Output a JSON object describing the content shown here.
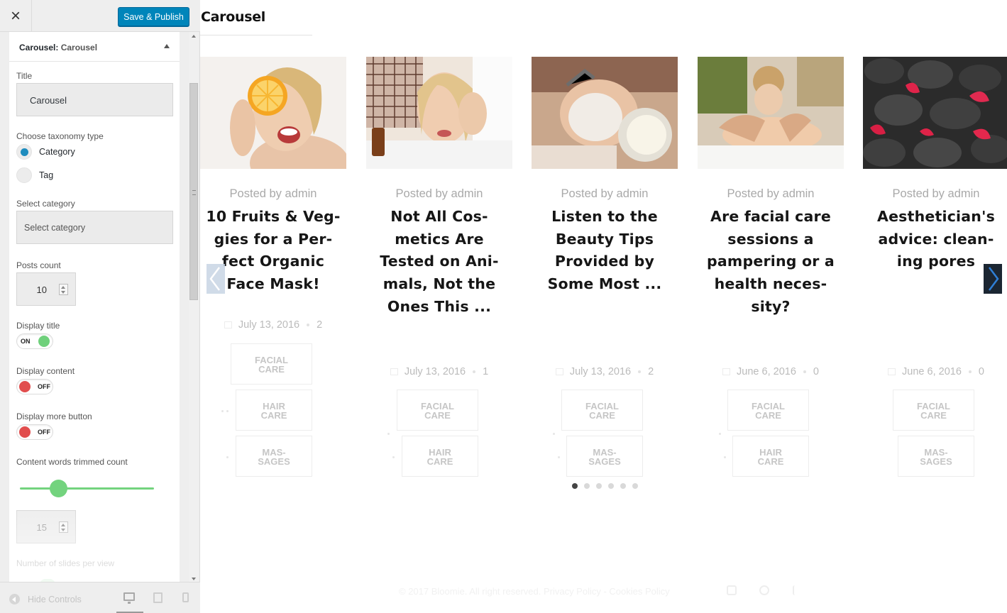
{
  "topbar": {
    "close_icon": "×",
    "save_label": "Save & Publish"
  },
  "panel": {
    "heading_prefix": "Carousel:",
    "heading_name": "Carousel",
    "title_label": "Title",
    "title_value": "Carousel",
    "taxonomy_label": "Choose taxonomy type",
    "taxonomy_options": [
      {
        "label": "Category",
        "checked": true
      },
      {
        "label": "Tag",
        "checked": false
      }
    ],
    "category_label": "Select category",
    "category_placeholder": "Select category",
    "posts_count_label": "Posts count",
    "posts_count_value": "10",
    "display_title_label": "Display title",
    "display_title_state": "ON",
    "display_content_label": "Display content",
    "display_content_state": "OFF",
    "display_more_label": "Display more button",
    "display_more_state": "OFF",
    "trim_label": "Content words trimmed count",
    "trim_slider_fraction": 0.29,
    "trim_value": "15",
    "slides_label": "Number of slides per view"
  },
  "footer_bar": {
    "hide_controls": "Hide Controls",
    "devices": [
      "desktop-icon",
      "tablet-icon",
      "mobile-icon"
    ],
    "active_device": "desktop"
  },
  "preview": {
    "widget_title": "Carousel",
    "posts": [
      {
        "posted": "Posted by admin",
        "title": "10 Fruits & Veg-\ngies for a Per-\nfect Organic\nFace Mask!",
        "date": "July 13, 2016",
        "comments": "2",
        "tags": [
          "FACIAL\nCARE",
          "HAIR\nCARE",
          "MAS-\nSAGES"
        ]
      },
      {
        "posted": "Posted by admin",
        "title": "Not All Cos-\nmetics Are\nTested on Ani-\nmals, Not the\nOnes This ...",
        "date": "July 13, 2016",
        "comments": "1",
        "tags": [
          "FACIAL\nCARE",
          "HAIR\nCARE"
        ]
      },
      {
        "posted": "Posted by admin",
        "title": "Listen to the\nBeauty Tips\nProvided by\nSome Most ...",
        "date": "July 13, 2016",
        "comments": "2",
        "tags": [
          "FACIAL\nCARE",
          "MAS-\nSAGES"
        ]
      },
      {
        "posted": "Posted by admin",
        "title": "Are facial care\nsessions a\npampering or a\nhealth neces-\nsity?",
        "date": "June 6, 2016",
        "comments": "0",
        "tags": [
          "FACIAL\nCARE",
          "HAIR\nCARE"
        ]
      },
      {
        "posted": "Posted by admin",
        "title": "Aesthetician's\nadvice: clean-\ning pores",
        "date": "June 6, 2016",
        "comments": "0",
        "tags": [
          "FACIAL\nCARE",
          "MAS-\nSAGES"
        ]
      }
    ],
    "pagination_count": 6,
    "pagination_active": 1,
    "site_footer": "© 2017 Bloomie. All right reserved. Privacy Policy - Cookies Policy",
    "social_icons": [
      "instagram-icon",
      "pinterest-icon",
      "facebook-icon"
    ]
  }
}
